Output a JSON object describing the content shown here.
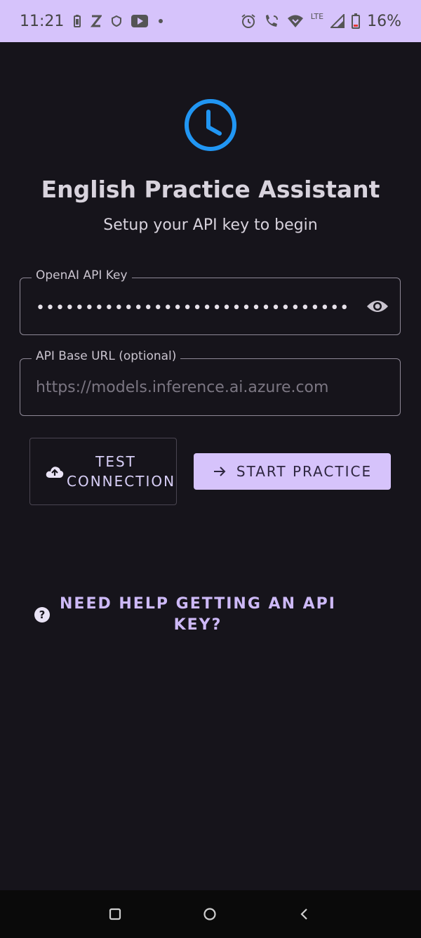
{
  "status_bar": {
    "time": "11:21",
    "battery_percent": "16%",
    "network": "LTE"
  },
  "app": {
    "title": "English Practice Assistant",
    "subtitle": "Setup your API key to begin",
    "accent_color": "#d6c3fb",
    "icon_color": "#2196f3"
  },
  "api_key_field": {
    "label": "OpenAI API Key",
    "masked_value": "••••••••••••••••••••••••••••••••••••••••••"
  },
  "base_url_field": {
    "label": "API Base URL (optional)",
    "placeholder": "https://models.inference.ai.azure.com"
  },
  "buttons": {
    "test_connection": "TEST CONNECTION",
    "start_practice": "START PRACTICE"
  },
  "help_link": "NEED HELP GETTING AN API KEY?",
  "nav": {
    "recents": "recents-icon",
    "home": "home-icon",
    "back": "back-icon"
  }
}
